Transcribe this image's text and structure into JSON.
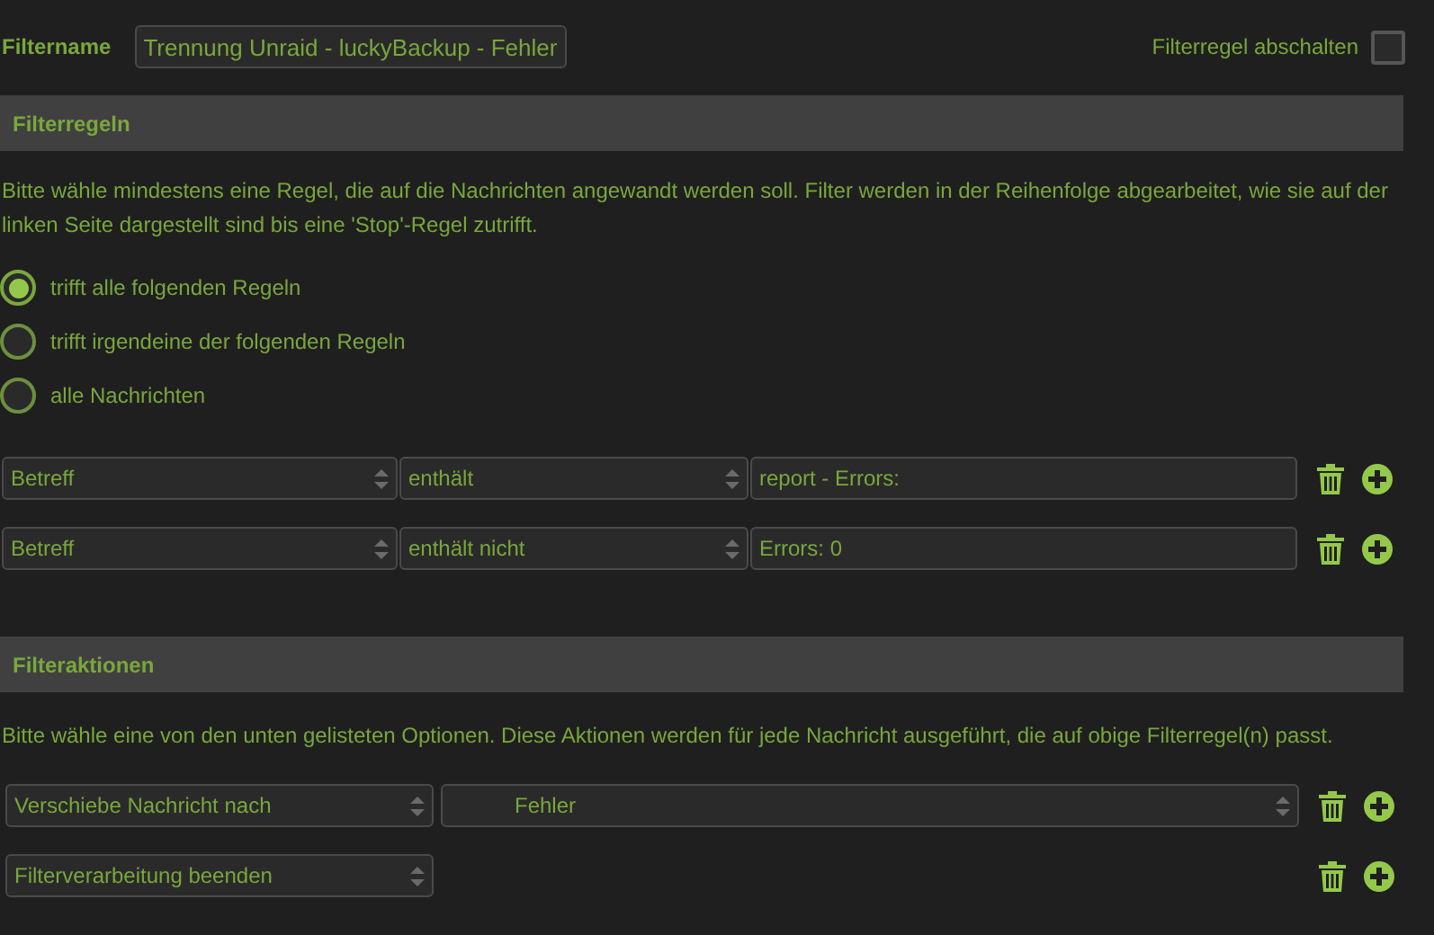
{
  "filter_name": {
    "label": "Filtername",
    "value": "Trennung Unraid - luckyBackup - Fehler"
  },
  "disable_rule": {
    "label": "Filterregel abschalten",
    "checked": false
  },
  "rules_section": {
    "title": "Filterregeln",
    "description": "Bitte wähle mindestens eine Regel, die auf die Nachrichten angewandt werden soll. Filter werden in der Reihenfolge abgearbeitet, wie sie auf der linken Seite dargestellt sind bis eine 'Stop'-Regel zutrifft.",
    "match_options": [
      {
        "label": "trifft alle folgenden Regeln",
        "selected": true
      },
      {
        "label": "trifft irgendeine der folgenden Regeln",
        "selected": false
      },
      {
        "label": "alle Nachrichten",
        "selected": false
      }
    ],
    "rules": [
      {
        "field": "Betreff",
        "operator": "enthält",
        "value": "report - Errors:"
      },
      {
        "field": "Betreff",
        "operator": "enthält nicht",
        "value": "Errors: 0"
      }
    ]
  },
  "actions_section": {
    "title": "Filteraktionen",
    "description": "Bitte wähle eine von den unten gelisteten Optionen. Diese Aktionen werden für jede Nachricht ausgeführt, die auf obige Filterregel(n) passt.",
    "actions": [
      {
        "action": "Verschiebe Nachricht nach",
        "target": "Fehler"
      },
      {
        "action": "Filterverarbeitung beenden"
      }
    ]
  }
}
